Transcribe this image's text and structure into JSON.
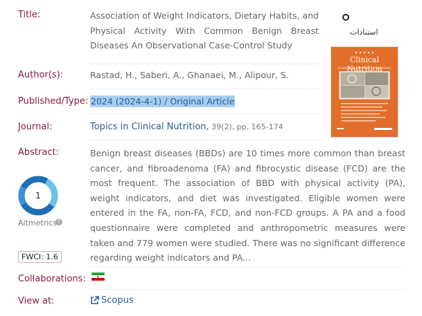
{
  "record": {
    "labels": {
      "title": "Title:",
      "authors": "Author(s):",
      "published": "Published/Type:",
      "journal": "Journal:",
      "abstract": "Abstract:",
      "collaborations": "Collaborations:",
      "view_at": "View at:"
    },
    "title": "Association of Weight Indicators, Dietary Habits, and Physical Activity With Common Benign Breast Diseases An Observational Case-Control Study",
    "authors": "Rastad, H., Saberi, A., Ghanaei, M., Alipour, S.",
    "published_type": "2024 (2024-4-1) / Original Article",
    "journal_name": "Topics in Clinical Nutrition,",
    "journal_details": " 39(2), pp. 165-174",
    "abstract": "Benign breast diseases (BBDs) are 10 times more common than breast cancer, and fibroadenoma (FA) and fibrocystic disease (FCD) are the most frequent. The association of BBD with physical activity (PA), weight indicators, and diet was investigated. Eligible women were entered in the FA, non-FA, FCD, and non-FCD groups. A PA and a food questionnaire were completed and anthropometric measures were taken and 779 women were studied. There was no significant difference regarding weight indicators and PA...",
    "view_at_link": "Scopus",
    "collaboration_flag": "iran-flag"
  },
  "sidebar": {
    "ostadat_label": "استنادات",
    "cover_title": "Clinical Nutrition",
    "cover_subtitle": "Changing the Face of Nutrition",
    "altmetric_score": "1",
    "altmetric_label": "Altmetrics",
    "help_glyph": "?",
    "fwci": "FWCI: 1.6"
  },
  "colors": {
    "label": "#8b1a3c",
    "link": "#2a5b9b",
    "cover": "#e36d2a",
    "altmetric": "#2a7fc0",
    "highlight": "#a9cdef"
  }
}
